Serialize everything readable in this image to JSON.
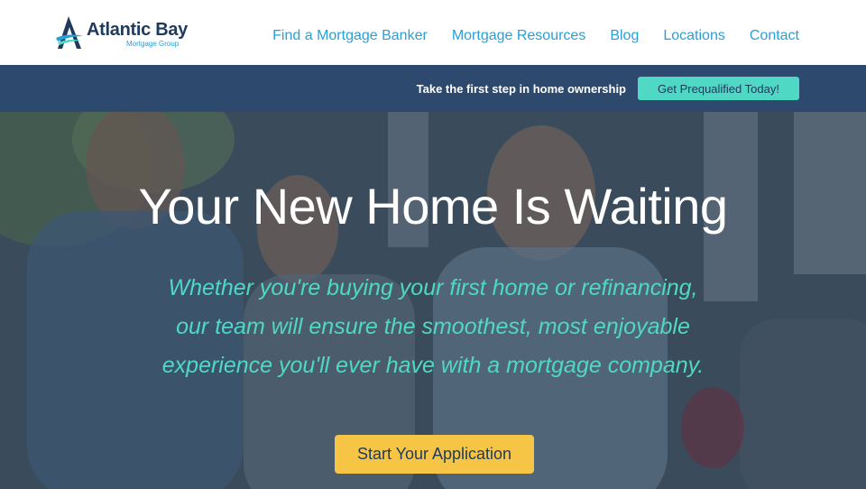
{
  "brand": {
    "name": "Atlantic Bay",
    "tagline": "Mortgage Group",
    "logo_icon": "a-sail-logo-icon"
  },
  "nav": {
    "items": [
      {
        "label": "Find a Mortgage Banker"
      },
      {
        "label": "Mortgage Resources"
      },
      {
        "label": "Blog"
      },
      {
        "label": "Locations"
      },
      {
        "label": "Contact"
      }
    ]
  },
  "promo": {
    "text": "Take the first step in home ownership",
    "button_label": "Get Prequalified Today!"
  },
  "hero": {
    "title": "Your New Home Is Waiting",
    "subtitle_lines": [
      "Whether you're buying your first home or refinancing,",
      "our team will ensure the smoothest, most enjoyable",
      "experience you'll ever have with a mortgage company."
    ],
    "cta_label": "Start Your Application"
  },
  "colors": {
    "navy": "#2d4a6e",
    "brand_blue": "#2a9fd6",
    "teal": "#4fd8c4",
    "yellow": "#f7c545"
  }
}
